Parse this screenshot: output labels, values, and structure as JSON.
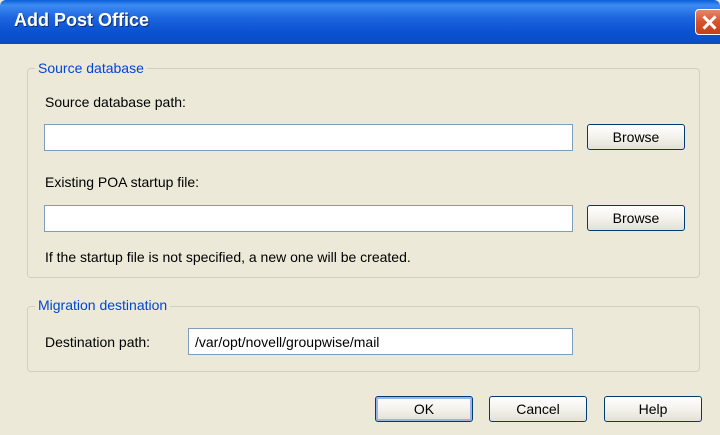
{
  "window": {
    "title": "Add Post Office"
  },
  "source_group": {
    "legend": "Source database",
    "db_path_label": "Source database path:",
    "db_path_value": "",
    "browse1_label": "Browse",
    "startup_label": "Existing POA startup file:",
    "startup_value": "",
    "browse2_label": "Browse",
    "note": "If the startup file is not specified, a new one will be created."
  },
  "migration_group": {
    "legend": "Migration destination",
    "dest_label": "Destination path:",
    "dest_value": "/var/opt/novell/groupwise/mail"
  },
  "buttons": {
    "ok": "OK",
    "cancel": "Cancel",
    "help": "Help"
  },
  "colors": {
    "titlebar": "#0a53d2",
    "legend": "#0046d5",
    "dialog_bg": "#ece9d8",
    "close": "#d6532c"
  }
}
